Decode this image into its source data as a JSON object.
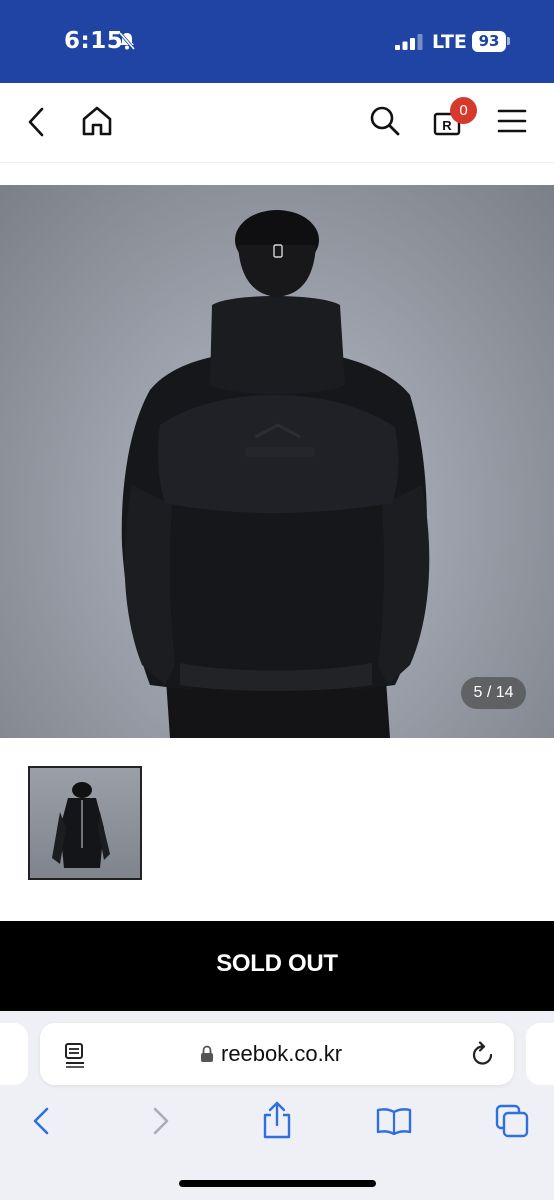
{
  "status_bar": {
    "time": "6:15",
    "network": "LTE",
    "battery": "93",
    "background_color": "#1f44a3"
  },
  "nav": {
    "back_icon": "chevron-left-icon",
    "home_icon": "home-icon",
    "search_icon": "search-icon",
    "cart_icon": "cart-bag-icon",
    "cart_count": "0",
    "menu_icon": "hamburger-menu-icon"
  },
  "gallery": {
    "counter": "5 / 14"
  },
  "product": {
    "sold_out_label": "SOLD OUT"
  },
  "browser": {
    "url": "reebok.co.kr",
    "reader_icon": "reader-mode-icon",
    "lock_icon": "lock-icon",
    "reload_icon": "reload-icon",
    "toolbar": [
      "back-icon",
      "forward-icon",
      "share-icon",
      "bookmarks-icon",
      "tabs-icon"
    ]
  }
}
